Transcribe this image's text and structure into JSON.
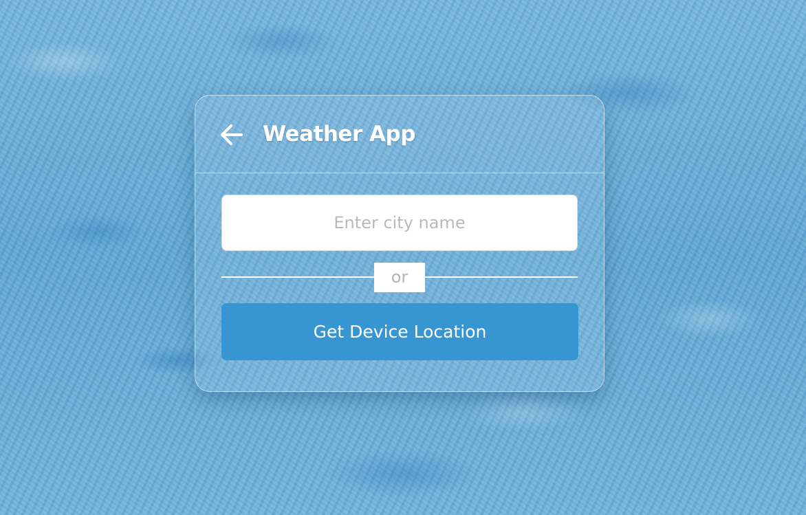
{
  "app": {
    "title": "Weather App",
    "back_icon": "arrow-left-icon"
  },
  "search": {
    "value": "",
    "placeholder": "Enter city name"
  },
  "divider": {
    "label": "or"
  },
  "location": {
    "button_label": "Get Device Location"
  },
  "colors": {
    "accent": "#3796d1",
    "header_text": "#ffffff",
    "placeholder": "#b9b9b9"
  }
}
